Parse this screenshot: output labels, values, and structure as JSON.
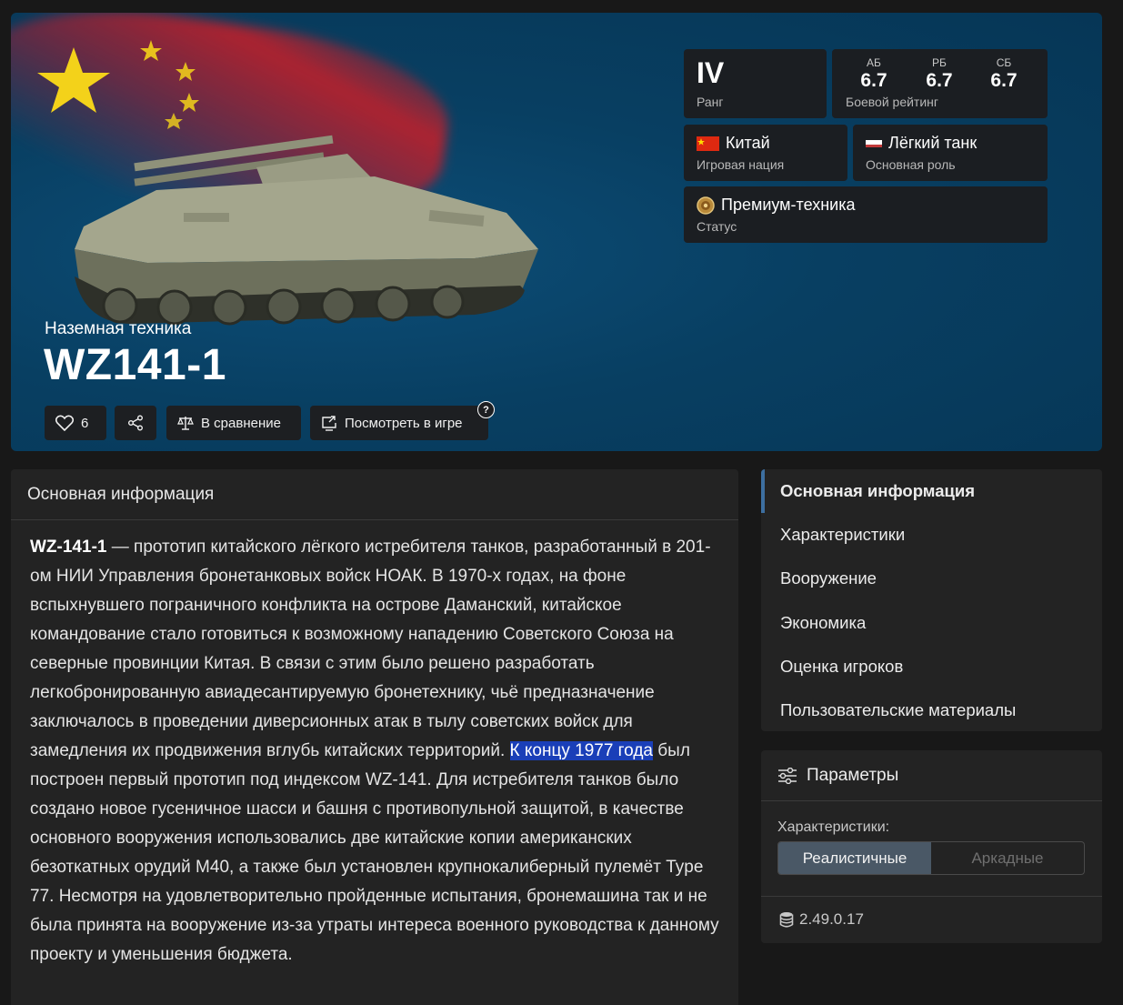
{
  "hero": {
    "category": "Наземная техника",
    "title": "WZ141-1",
    "likes": "6",
    "compare_label": "В сравнение",
    "view_label": "Посмотреть в игре",
    "help_glyph": "?"
  },
  "stats": {
    "rank_value": "IV",
    "rank_label": "Ранг",
    "br_modes": [
      {
        "mode": "АБ",
        "value": "6.7"
      },
      {
        "mode": "РБ",
        "value": "6.7"
      },
      {
        "mode": "СБ",
        "value": "6.7"
      }
    ],
    "br_label": "Боевой рейтинг",
    "nation": "Китай",
    "nation_label": "Игровая нация",
    "role": "Лёгкий танк",
    "role_label": "Основная роль",
    "status": "Премиум-техника",
    "status_label": "Статус"
  },
  "main": {
    "header": "Основная информация",
    "name_bold": "WZ-141-1",
    "text_part1": " — прототип китайского лёгкого истребителя танков, разработанный в 201-ом НИИ Управления бронетанковых войск НОАК. В 1970-х годах, на фоне вспыхнувшего пограничного конфликта на острове Даманский, китайское командование стало готовиться к возможному нападению Советского Союза на северные провинции Китая. В связи с этим было решено разработать легкобронированную авиадесантируемую бронетехнику, чьё предназначение заключалось в проведении диверсионных атак в тылу советских войск для замедления их продвижения вглубь китайских территорий. ",
    "highlight": "К концу 1977 года",
    "text_part2": " был построен первый прототип под индексом WZ-141. Для истребителя танков было создано новое гусеничное шасси и башня с противопульной защитой, в качестве основного вооружения использовались две китайские копии американских безоткатных орудий M40, а также был установлен крупнокалиберный пулемёт Type 77. Несмотря на удовлетворительно пройденные испытания, бронемашина так и не была принята на вооружение из-за утраты интереса военного руководства к данному проекту и уменьшения бюджета."
  },
  "nav": {
    "items": [
      {
        "label": "Основная информация",
        "active": true
      },
      {
        "label": "Характеристики"
      },
      {
        "label": "Вооружение"
      },
      {
        "label": "Экономика"
      },
      {
        "label": "Оценка игроков"
      },
      {
        "label": "Пользовательские материалы"
      }
    ]
  },
  "params": {
    "header": "Параметры",
    "label": "Характеристики:",
    "options": [
      "Реалистичные",
      "Аркадные"
    ],
    "selected": "Реалистичные",
    "version": "2.49.0.17"
  },
  "colors": {
    "hero_bg": "#0a4468",
    "panel_bg": "#232323",
    "card_bg": "#1b1e22",
    "highlight": "#1a3fb8",
    "accent": "#3d6fa0"
  }
}
